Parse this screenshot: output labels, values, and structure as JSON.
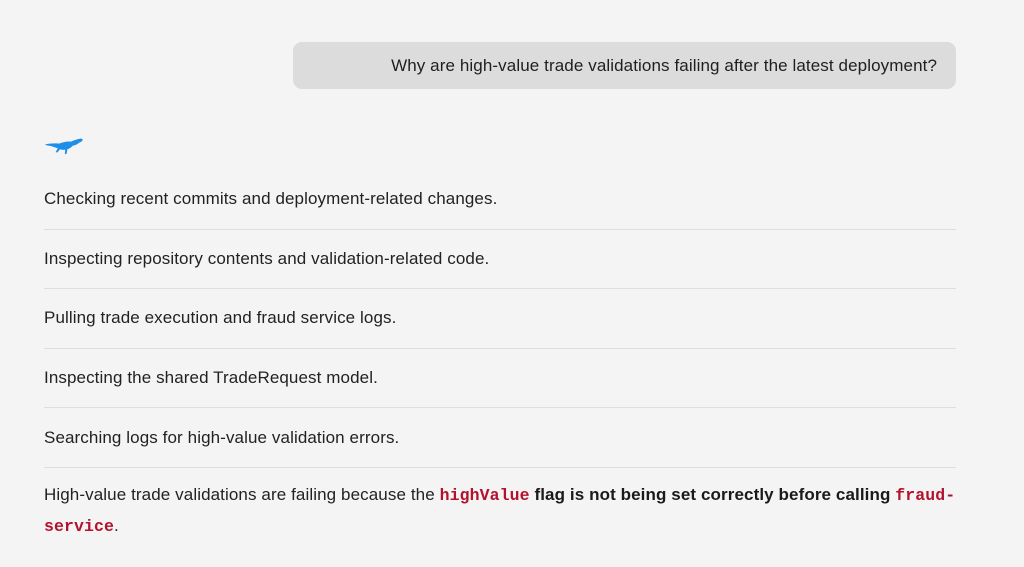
{
  "conversation": {
    "user_message": "Why are high-value trade validations failing after the latest deployment?",
    "assistant": {
      "logo_icon": "running-cheetah-logo-icon",
      "accent_color": "#1e8fe8",
      "steps": [
        "Checking recent commits and deployment-related changes.",
        "Inspecting repository contents and validation-related code.",
        "Pulling trade execution and fraud service logs.",
        "Inspecting the shared TradeRequest model.",
        "Searching logs for high-value validation errors."
      ],
      "answer": {
        "part1": "High-value trade validations are failing because the ",
        "code1": "highValue",
        "part2": " flag is not being set correctly before calling ",
        "code2": "fraud-service",
        "part3": "."
      },
      "code_color": "#b3122c"
    }
  }
}
